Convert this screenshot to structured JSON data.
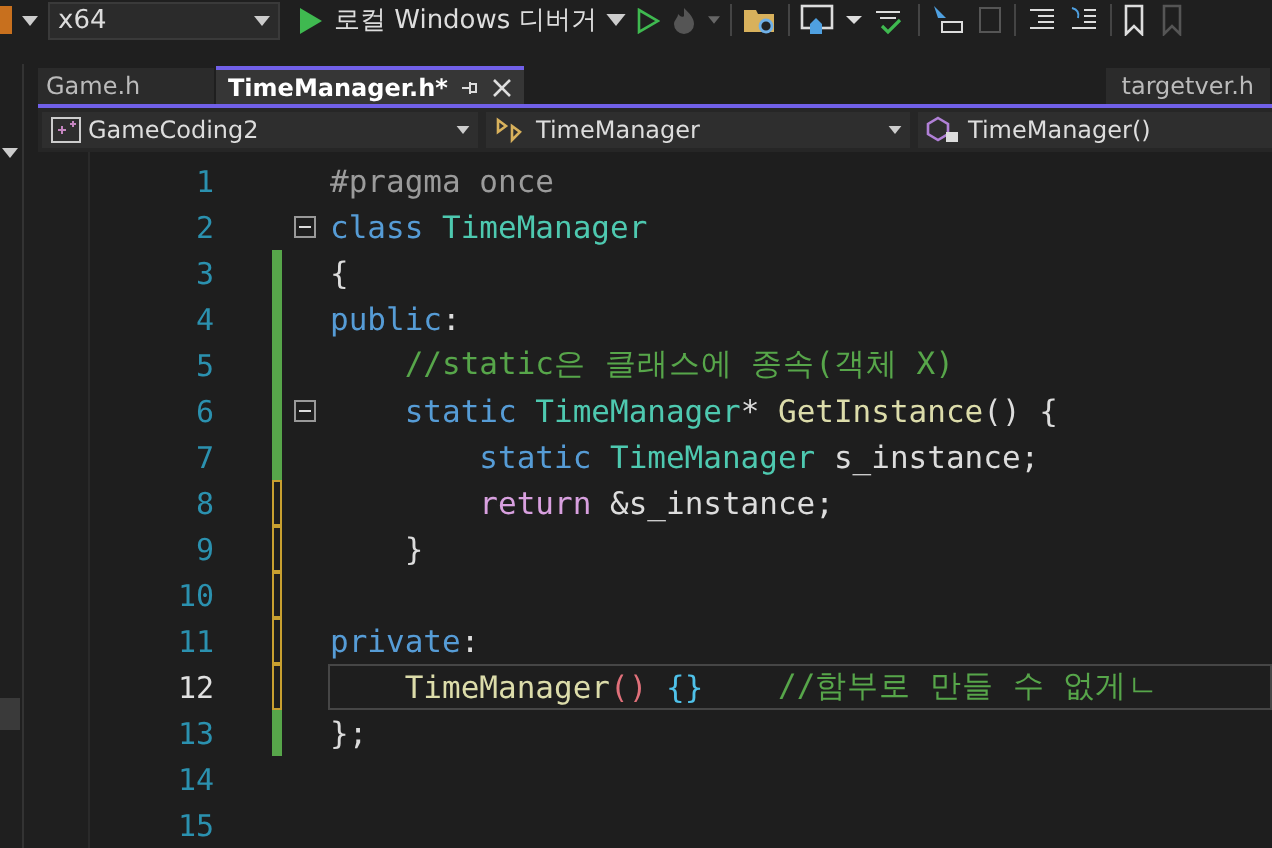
{
  "toolbar": {
    "platform": "x64",
    "debugger": "로컬 Windows 디버거"
  },
  "tabs": [
    {
      "label": "Game.h",
      "selected": false
    },
    {
      "label": "TimeManager.h*",
      "selected": true
    }
  ],
  "right_tab": {
    "label": "targetver.h"
  },
  "navigation": {
    "project": "GameCoding2",
    "scope": "TimeManager",
    "member": "TimeManager()"
  },
  "lines": [
    {
      "number": "1",
      "modified": false,
      "fold": false,
      "current": false,
      "tokens": [
        {
          "kind": "preproc",
          "text": "#pragma once"
        }
      ]
    },
    {
      "number": "2",
      "modified": false,
      "fold": true,
      "current": false,
      "tokens": [
        {
          "kind": "keyword",
          "text": "class "
        },
        {
          "kind": "type",
          "text": "TimeManager"
        }
      ]
    },
    {
      "number": "3",
      "modified": true,
      "saved": true,
      "fold": false,
      "current": false,
      "tokens": [
        {
          "kind": "plain",
          "text": "{"
        }
      ]
    },
    {
      "number": "4",
      "modified": true,
      "saved": true,
      "fold": false,
      "current": false,
      "tokens": [
        {
          "kind": "keyword",
          "text": "public"
        },
        {
          "kind": "plain",
          "text": ":"
        }
      ]
    },
    {
      "number": "5",
      "modified": true,
      "saved": true,
      "fold": false,
      "current": false,
      "tokens": [
        {
          "kind": "comment",
          "text": "    //static은 클래스에 종속(객체 X)"
        }
      ]
    },
    {
      "number": "6",
      "modified": true,
      "saved": true,
      "fold": true,
      "current": false,
      "tokens": [
        {
          "kind": "keyword",
          "text": "    static "
        },
        {
          "kind": "type",
          "text": "TimeManager"
        },
        {
          "kind": "plain",
          "text": "* "
        },
        {
          "kind": "function",
          "text": "GetInstance"
        },
        {
          "kind": "plain",
          "text": "() {"
        }
      ]
    },
    {
      "number": "7",
      "modified": true,
      "saved": true,
      "fold": false,
      "current": false,
      "tokens": [
        {
          "kind": "keyword",
          "text": "        static "
        },
        {
          "kind": "type",
          "text": "TimeManager"
        },
        {
          "kind": "plain",
          "text": " s_instance;"
        }
      ]
    },
    {
      "number": "8",
      "modified": true,
      "saved": false,
      "fold": false,
      "current": false,
      "tokens": [
        {
          "kind": "control",
          "text": "        return"
        },
        {
          "kind": "plain",
          "text": " &s_instance;"
        }
      ]
    },
    {
      "number": "9",
      "modified": true,
      "saved": false,
      "fold": false,
      "current": false,
      "tokens": [
        {
          "kind": "plain",
          "text": "    }"
        }
      ]
    },
    {
      "number": "10",
      "modified": true,
      "saved": false,
      "fold": false,
      "current": false
    },
    {
      "number": "11",
      "modified": true,
      "saved": false,
      "fold": false,
      "current": false,
      "tokens": [
        {
          "kind": "keyword",
          "text": "private"
        },
        {
          "kind": "plain",
          "text": ":"
        }
      ]
    },
    {
      "number": "12",
      "modified": true,
      "saved": false,
      "fold": false,
      "current": true,
      "tokens": [
        {
          "kind": "function",
          "text": "    TimeManager"
        },
        {
          "kind": "bracket-a",
          "text": "()"
        },
        {
          "kind": "bracket-b",
          "text": " {}"
        },
        {
          "kind": "comment",
          "text": "    //함부로 만들 수 없게ㄴ"
        }
      ]
    },
    {
      "number": "13",
      "modified": true,
      "saved": true,
      "fold": false,
      "current": false,
      "tokens": [
        {
          "kind": "plain",
          "text": "};"
        }
      ]
    },
    {
      "number": "14",
      "modified": false,
      "fold": false,
      "current": false
    },
    {
      "number": "15",
      "modified": false,
      "fold": false,
      "current": false
    }
  ]
}
